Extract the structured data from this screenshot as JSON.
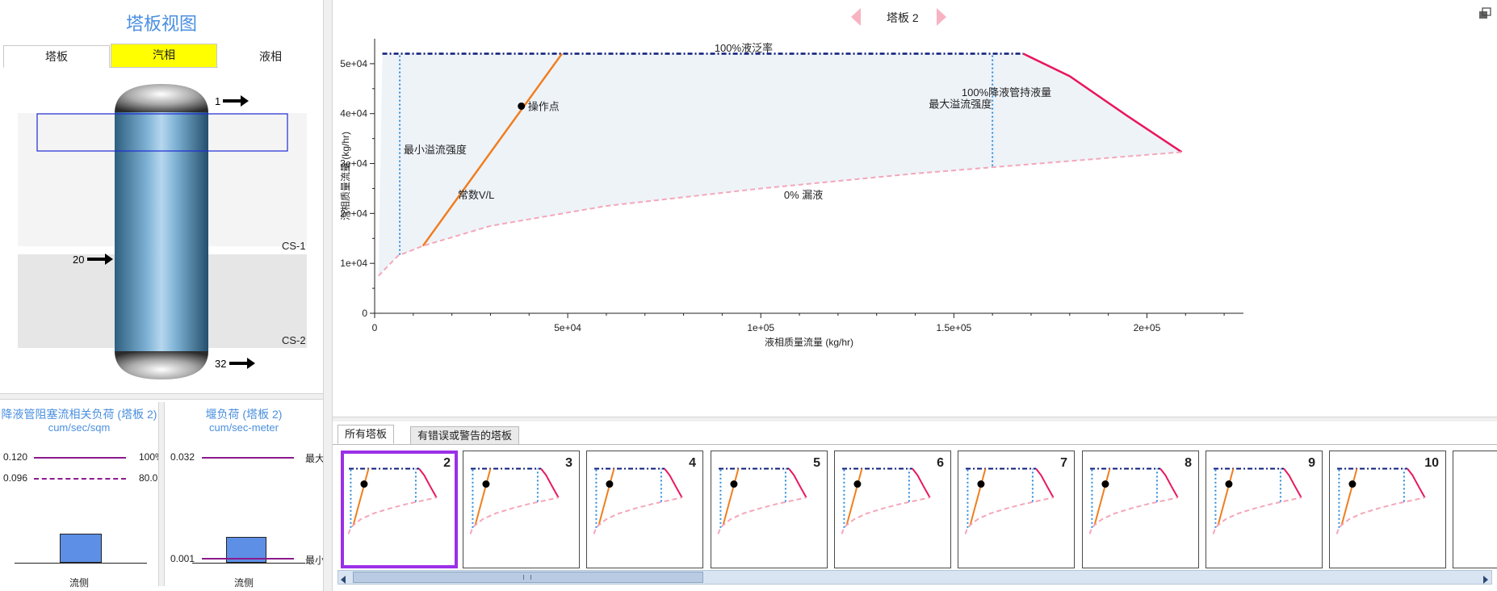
{
  "left": {
    "title": "塔板视图",
    "tabs": [
      {
        "label": "塔板",
        "active": false
      },
      {
        "label": "汽相",
        "active": true
      },
      {
        "label": "液相",
        "active": false
      }
    ],
    "streams": {
      "s1": "1",
      "s20": "20",
      "s32": "32"
    },
    "sections": {
      "cs1": "CS-1",
      "cs2": "CS-2"
    },
    "gauge1": {
      "title": "降液管阻塞流相关负荷 (塔板 2)",
      "unit": "cum/sec/sqm",
      "v_top": "0.120",
      "v_mid": "0.096",
      "r_top": "100%",
      "r_mid": "80.0",
      "xlabel": "流侧"
    },
    "gauge2": {
      "title": "堰负荷 (塔板 2)",
      "unit": "cum/sec-meter",
      "v_top": "0.032",
      "v_bot": "0.001",
      "r_top": "最大",
      "r_bot": "最小",
      "xlabel": "流侧"
    }
  },
  "nav": {
    "title": "塔板 2"
  },
  "colors": {
    "accent": "#4a8fe0",
    "selected_thumb": "#9b30e8",
    "tab_active": "#ffff00",
    "vl": "#f07e1e",
    "flood": "#0a1a7a",
    "downcomer": "#e8175d",
    "weep": "#f4a7b9",
    "limit": "#2a8be0"
  },
  "chart_data": {
    "type": "line",
    "xlabel": "液相质量流量 (kg/hr)",
    "ylabel": "汽相质量流量 (kg/hr)",
    "xlim": [
      0,
      225000
    ],
    "ylim": [
      0,
      55000
    ],
    "xticks": [
      "0",
      "5e+04",
      "1e+05",
      "1.5e+05",
      "2e+05"
    ],
    "xtick_values": [
      0,
      50000,
      100000,
      150000,
      200000
    ],
    "yticks": [
      "0",
      "1e+04",
      "2e+04",
      "3e+04",
      "4e+04",
      "5e+04"
    ],
    "ytick_values": [
      0,
      10000,
      20000,
      30000,
      40000,
      50000
    ],
    "series": [
      {
        "name": "100%液泛率",
        "style": "dashdot",
        "color": "#0a1a7a",
        "x": [
          2000,
          168000
        ],
        "y": [
          52000,
          52000
        ]
      },
      {
        "name": "常数V/L",
        "style": "solid",
        "color": "#f07e1e",
        "x": [
          12500,
          48500
        ],
        "y": [
          13500,
          52000
        ]
      },
      {
        "name": "100%降液管持液量",
        "style": "solid",
        "color": "#e8175d",
        "x": [
          168000,
          180000,
          195000,
          209000
        ],
        "y": [
          52000,
          47500,
          39500,
          32300
        ]
      },
      {
        "name": "0% 漏液",
        "style": "dashed",
        "color": "#f4a7b9",
        "x": [
          1000,
          6000,
          12500,
          30000,
          60000,
          100000,
          140000,
          180000,
          209000
        ],
        "y": [
          7500,
          11500,
          13500,
          17500,
          21500,
          25000,
          28000,
          30500,
          32300
        ]
      },
      {
        "name": "最小溢流强度",
        "style": "dotted",
        "color": "#2a8be0",
        "x": [
          6500,
          6500
        ],
        "y": [
          11700,
          52000
        ]
      },
      {
        "name": "最大溢流强度",
        "style": "dotted",
        "color": "#2a8be0",
        "x": [
          160000,
          160000
        ],
        "y": [
          29500,
          52000
        ]
      }
    ],
    "operating_point": {
      "label": "操作点",
      "x": 38000,
      "y": 41500
    },
    "annotations": [
      {
        "text": "100%液泛率",
        "x": 88000,
        "y": 52400
      },
      {
        "text": "最小溢流强度",
        "x": 7500,
        "y": 32000
      },
      {
        "text": "常数V/L",
        "x": 21500,
        "y": 23000
      },
      {
        "text": "0% 漏液",
        "x": 106000,
        "y": 23000
      },
      {
        "text": "100%降液管持液量",
        "x": 152000,
        "y": 43500
      },
      {
        "text": "最大溢流强度",
        "x": 143500,
        "y": 41200
      }
    ]
  },
  "bottom_tabs": [
    {
      "label": "所有塔板",
      "selected": true
    },
    {
      "label": "有错误或警告的塔板",
      "selected": false
    }
  ],
  "thumbnails": [
    "2",
    "3",
    "4",
    "5",
    "6",
    "7",
    "8",
    "9",
    "10"
  ]
}
